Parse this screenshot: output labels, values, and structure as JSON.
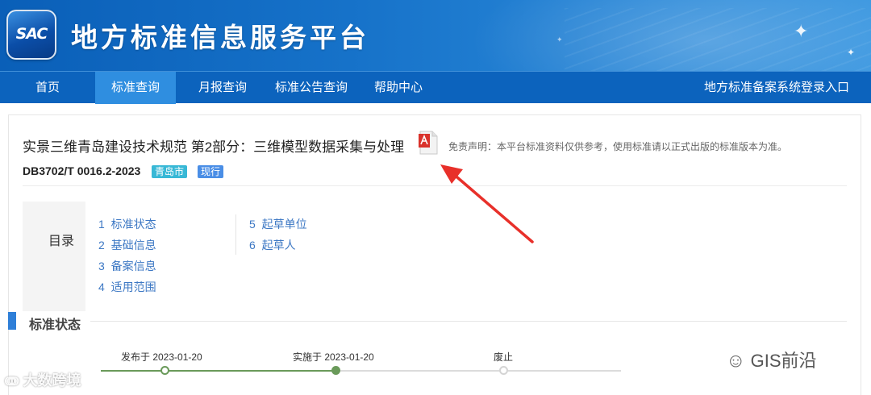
{
  "header": {
    "logo_text": "SAC",
    "site_title": "地方标准信息服务平台"
  },
  "nav": {
    "items": [
      {
        "label": "首页",
        "active": false
      },
      {
        "label": "标准查询",
        "active": true
      },
      {
        "label": "月报查询",
        "active": false
      },
      {
        "label": "标准公告查询",
        "active": false
      },
      {
        "label": "帮助中心",
        "active": false
      }
    ],
    "login_link": "地方标准备案系统登录入口"
  },
  "standard": {
    "title": "实景三维青岛建设技术规范 第2部分：三维模型数据采集与处理",
    "pdf_icon": "pdf-icon",
    "disclaimer": "免责声明：本平台标准资料仅供参考，使用标准请以正式出版的标准版本为准。",
    "code": "DB3702/T 0016.2-2023",
    "badge_city": "青岛市",
    "badge_status": "现行"
  },
  "toc": {
    "label": "目录",
    "items": [
      {
        "num": "1",
        "label": "标准状态"
      },
      {
        "num": "2",
        "label": "基础信息"
      },
      {
        "num": "3",
        "label": "备案信息"
      },
      {
        "num": "4",
        "label": "适用范围"
      },
      {
        "num": "5",
        "label": "起草单位"
      },
      {
        "num": "6",
        "label": "起草人"
      }
    ]
  },
  "status_section": {
    "title": "标准状态",
    "timeline": [
      {
        "label": "发布于 2023-01-20",
        "state": "done"
      },
      {
        "label": "实施于 2023-01-20",
        "state": "current"
      },
      {
        "label": "废止",
        "state": "pending"
      }
    ]
  },
  "watermarks": {
    "left": "大数跨境",
    "right": "GIS前沿"
  },
  "colors": {
    "banner": "#0a5fb8",
    "nav": "#0c63bd",
    "nav_active": "#2f8ee0",
    "link": "#3d78c4",
    "timeline": "#6a9a5a",
    "arrow": "#e8302a"
  }
}
